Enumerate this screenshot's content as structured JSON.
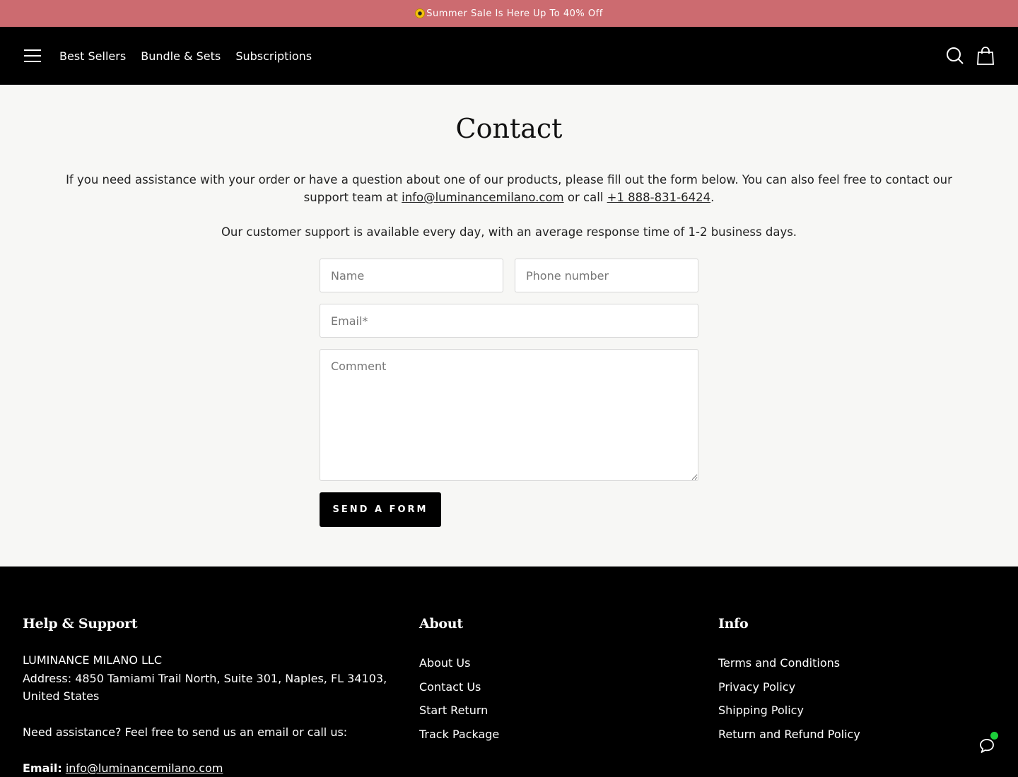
{
  "announcement": {
    "text": "Summer Sale Is Here Up To 40% Off",
    "icon": "sun-icon"
  },
  "header": {
    "nav": [
      "Best Sellers",
      "Bundle & Sets",
      "Subscriptions"
    ],
    "icons": [
      "menu-icon",
      "search-icon",
      "cart-icon"
    ]
  },
  "main": {
    "title": "Contact",
    "intro_before": "If you need assistance with your order or have a question about one of our products, please fill out the form below. You can also feel free to contact our support team at ",
    "email": "info@luminancemilano.com",
    "intro_middle": " or call ",
    "phone": "+1 888-831-6424",
    "intro_end": ".",
    "support_text": "Our customer support is available every day, with an average response time of 1-2 business days."
  },
  "form": {
    "name_placeholder": "Name",
    "phone_placeholder": "Phone number",
    "email_placeholder": "Email*",
    "comment_placeholder": "Comment",
    "submit_label": "SEND A FORM"
  },
  "footer": {
    "help": {
      "heading": "Help & Support",
      "company": "LUMINANCE MILANO LLC",
      "address": "Address: 4850 Tamiami Trail North, Suite 301, Naples, FL 34103, United States",
      "assist": "Need assistance? Feel free to send us an email or call us:",
      "email_label": "Email:",
      "email": "info@luminancemilano.com"
    },
    "about": {
      "heading": "About",
      "links": [
        "About Us",
        "Contact Us",
        "Start Return",
        "Track Package"
      ]
    },
    "info": {
      "heading": "Info",
      "links": [
        "Terms and Conditions",
        "Privacy Policy",
        "Shipping Policy",
        "Return and Refund Policy"
      ]
    }
  },
  "chat": {
    "icon": "chat-bubble-icon",
    "status_color": "#1ccf3a"
  },
  "colors": {
    "announcement_bg": "#cc6b70",
    "header_bg": "#000000",
    "page_bg": "#f7f7f5",
    "footer_bg": "#000000"
  }
}
